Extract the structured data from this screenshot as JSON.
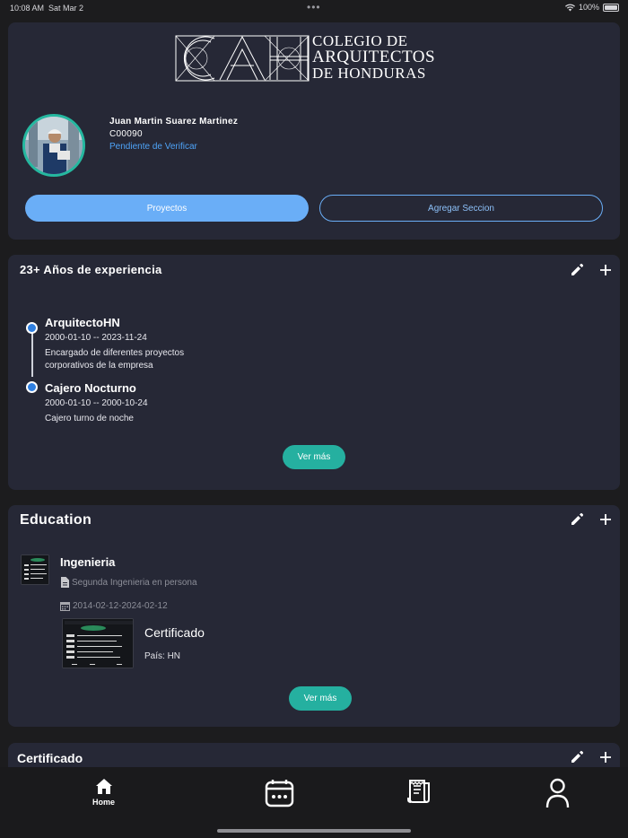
{
  "status_bar": {
    "time": "10:08 AM",
    "date": "Sat Mar 2",
    "battery": "100%"
  },
  "logo": {
    "line1": "Colegio de",
    "line2": "Arquitectos",
    "line3": "de Honduras"
  },
  "profile": {
    "name": "Juan Martin Suarez Martinez",
    "code": "C00090",
    "status": "Pendiente de Verificar",
    "status_color": "#4ea3f7",
    "buttons": {
      "projects": "Proyectos",
      "add_section": "Agregar Seccion"
    }
  },
  "experience": {
    "title": "23+ Años de experiencia",
    "items": [
      {
        "role": "ArquitectoHN",
        "dates": "2000-01-10 -- 2023-11-24",
        "description_1": "Encargado de diferentes proyectos",
        "description_2": "corporativos de la empresa"
      },
      {
        "role": "Cajero Nocturno",
        "dates": "2000-01-10 -- 2000-10-24",
        "description_1": "Cajero turno de noche",
        "description_2": ""
      }
    ],
    "more_button": "Ver más"
  },
  "education": {
    "title": "Education",
    "item": {
      "name": "Ingenieria",
      "description": "Segunda Ingenieria en persona",
      "dates": "2014-02-12-2024-02-12",
      "certificate_title": "Certificado",
      "country": "País: HN"
    },
    "more_button": "Ver más"
  },
  "certificates": {
    "title": "Certificado"
  },
  "tab_bar": {
    "home_label": "Home"
  },
  "colors": {
    "accent_blue": "#6aaef7",
    "accent_teal": "#25b0a0",
    "card_bg": "#262836"
  }
}
